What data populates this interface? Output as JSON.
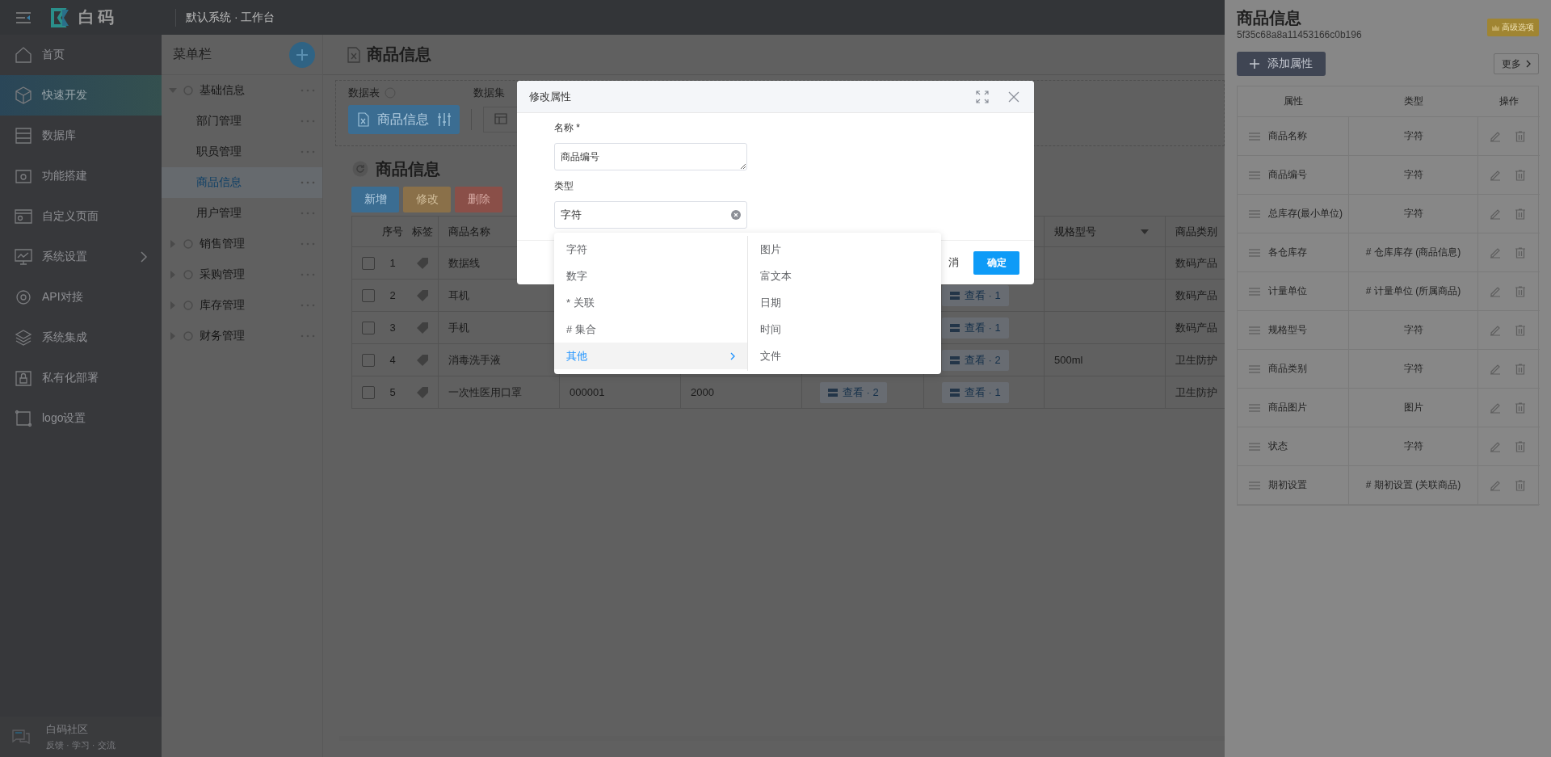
{
  "top_bar": {
    "logo_text": "白码",
    "workspace": "默认系统 · 工作台"
  },
  "sidebar": {
    "items": [
      {
        "label": "首页",
        "selected": false,
        "has_submenu": false
      },
      {
        "label": "快速开发",
        "selected": true,
        "has_submenu": false
      },
      {
        "label": "数据库",
        "selected": false,
        "has_submenu": false
      },
      {
        "label": "功能搭建",
        "selected": false,
        "has_submenu": false
      },
      {
        "label": "自定义页面",
        "selected": false,
        "has_submenu": false
      },
      {
        "label": "系统设置",
        "selected": false,
        "has_submenu": true
      },
      {
        "label": "API对接",
        "selected": false,
        "has_submenu": false
      },
      {
        "label": "系统集成",
        "selected": false,
        "has_submenu": false
      },
      {
        "label": "私有化部署",
        "selected": false,
        "has_submenu": false
      },
      {
        "label": "logo设置",
        "selected": false,
        "has_submenu": false
      }
    ],
    "footer": {
      "title": "白码社区",
      "subtitle": "反馈 · 学习 · 交流"
    }
  },
  "menu_panel": {
    "title": "菜单栏",
    "tree": [
      {
        "label": "基础信息",
        "expanded": true,
        "selected": false,
        "children": [
          {
            "label": "部门管理",
            "selected": false
          },
          {
            "label": "职员管理",
            "selected": false
          },
          {
            "label": "商品信息",
            "selected": true
          },
          {
            "label": "用户管理",
            "selected": false
          }
        ]
      },
      {
        "label": "销售管理",
        "expanded": false,
        "selected": false
      },
      {
        "label": "采购管理",
        "expanded": false,
        "selected": false
      },
      {
        "label": "库存管理",
        "expanded": false,
        "selected": false
      },
      {
        "label": "财务管理",
        "expanded": false,
        "selected": false
      }
    ]
  },
  "page": {
    "title": "商品信息",
    "data_table_label": "数据表",
    "data_set_label": "数据集",
    "table_button": "商品信息",
    "list_title": "商品信息",
    "actions": [
      {
        "label": "新增",
        "kind": "add"
      },
      {
        "label": "修改",
        "kind": "edit"
      },
      {
        "label": "删除",
        "kind": "delete"
      }
    ],
    "header": {
      "index": "序号",
      "tag": "标签",
      "name": "商品名称",
      "spec": "规格型号",
      "category": "商品类别"
    },
    "rows": [
      {
        "checked": false,
        "index": "1",
        "name": "数据线",
        "category": "数码产品"
      },
      {
        "checked": false,
        "index": "2",
        "name": "耳机",
        "column_7": "查看 · 1",
        "category": "数码产品"
      },
      {
        "checked": false,
        "index": "3",
        "name": "手机",
        "column_7": "查看 · 1",
        "category": "数码产品"
      },
      {
        "checked": false,
        "index": "4",
        "name": "消毒洗手液",
        "column_7": "查看 · 2",
        "spec": "500ml",
        "category": "卫生防护"
      },
      {
        "checked": false,
        "index": "5",
        "name": "一次性医用口罩",
        "column_4": "000001",
        "column_5": "2000",
        "column_6": "查看 · 2",
        "column_7": "查看 · 1",
        "category": "卫生防护"
      }
    ]
  },
  "dialog": {
    "title": "修改属性",
    "fields": [
      {
        "label": "名称 *",
        "value": "商品编号",
        "kind": "textarea"
      },
      {
        "label": "类型",
        "value": "字符",
        "kind": "select"
      }
    ],
    "cancel": "消",
    "confirm": "确定"
  },
  "dropdown": {
    "options": [
      {
        "label": "字符",
        "selected": false,
        "has_children": false
      },
      {
        "label": "数字",
        "selected": false,
        "has_children": false
      },
      {
        "label": "* 关联",
        "selected": false,
        "has_children": false
      },
      {
        "label": "# 集合",
        "selected": false,
        "has_children": false
      },
      {
        "label": "其他",
        "selected": true,
        "has_children": true
      }
    ],
    "sub_options": [
      {
        "label": "图片"
      },
      {
        "label": "富文本"
      },
      {
        "label": "日期"
      },
      {
        "label": "时间"
      },
      {
        "label": "文件"
      }
    ]
  },
  "drawer": {
    "title": "商品信息",
    "id": "5f35c68a8a11453166c0b196",
    "badge": "高级选项",
    "add_button": "添加属性",
    "more_button": "更多",
    "columns": [
      "属性",
      "类型",
      "操作"
    ],
    "rows": [
      {
        "name": "商品名称",
        "type": "字符"
      },
      {
        "name": "商品编号",
        "type": "字符"
      },
      {
        "name": "总库存(最小单位)",
        "type": "字符"
      },
      {
        "name": "各仓库存",
        "type": "# 仓库库存 (商品信息)"
      },
      {
        "name": "计量单位",
        "type": "# 计量单位 (所属商品)"
      },
      {
        "name": "规格型号",
        "type": "字符"
      },
      {
        "name": "商品类别",
        "type": "字符"
      },
      {
        "name": "商品图片",
        "type": "图片"
      },
      {
        "name": "状态",
        "type": "字符"
      },
      {
        "name": "期初设置",
        "type": "# 期初设置 (关联商品)"
      }
    ]
  }
}
